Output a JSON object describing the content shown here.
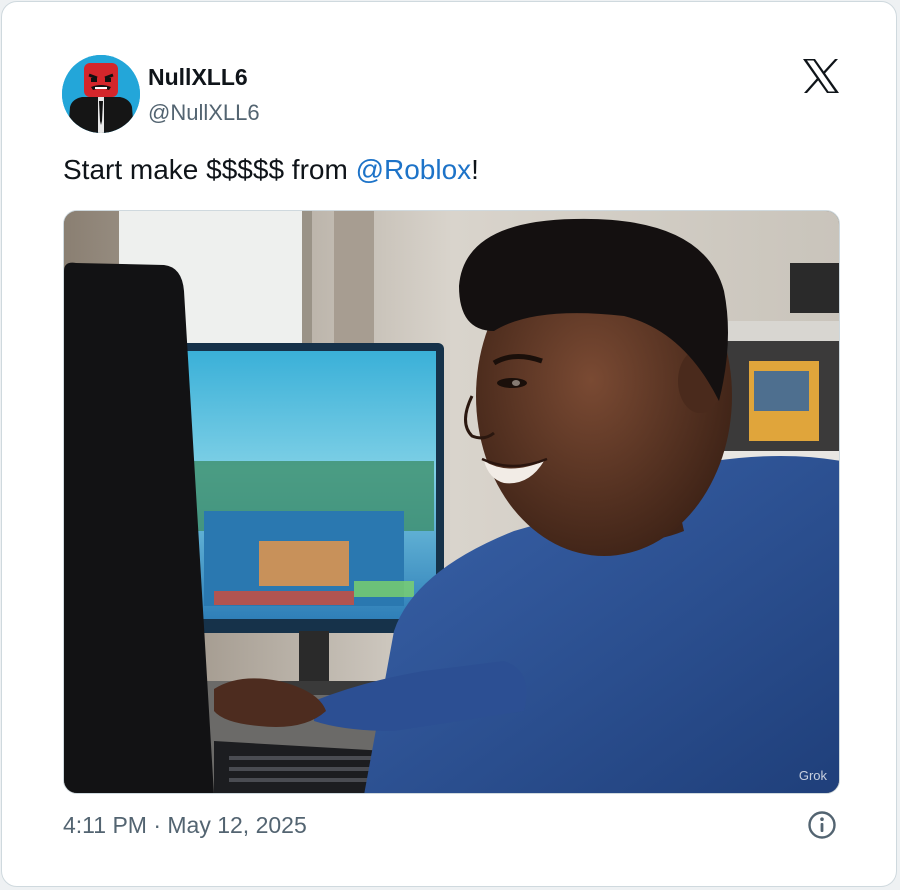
{
  "tweet": {
    "display_name": "NullXLL6",
    "handle": "@NullXLL6",
    "text_prefix": "Start make $$$$$ from ",
    "mention": "@Roblox",
    "text_suffix": "!",
    "timestamp": "4:11 PM · May 12, 2025"
  },
  "media": {
    "watermark": "Grok"
  },
  "icons": {
    "platform": "x-logo-icon",
    "info": "info-icon"
  },
  "colors": {
    "mention": "#1d73c8",
    "secondary_text": "#536471",
    "primary_text": "#0f1419",
    "shirt": "#2f5599"
  }
}
